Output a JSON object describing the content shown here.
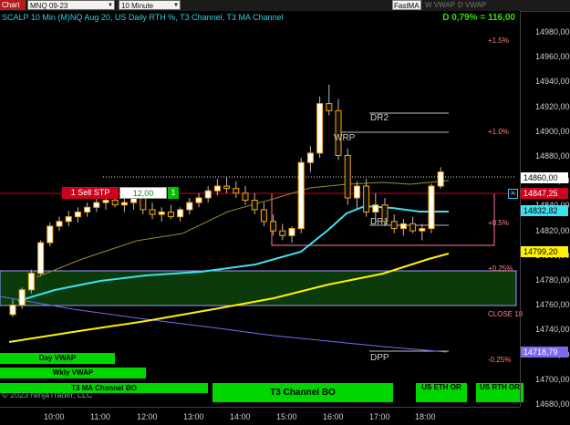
{
  "toolbar": {
    "chart_tab": "Chart",
    "instrument": "MNQ 09-23",
    "interval": "10 Minute",
    "fastma": "FastMA",
    "w_vwap": "W VWAP",
    "d_vwap": "D VWAP"
  },
  "chart_title": "SCALP 10 Min (M)NQ Aug 20, US Daily RTH %, T3 Channel, T3 MA Channel",
  "pnl": "D 0,79% = 116,00",
  "price_axis": [
    "14980,00",
    "14960,00",
    "14940,00",
    "14920,00",
    "14900,00",
    "14880,00",
    "14860,00",
    "14840,00",
    "14820,00",
    "14800,00",
    "14780,00",
    "14760,00",
    "14740,00",
    "14720,00",
    "14700,00",
    "14680,00"
  ],
  "price_flags": [
    {
      "label": "14860,00",
      "bg": "#ffffff",
      "fg": "#000000"
    },
    {
      "label": "14847,25",
      "bg": "#d0021b",
      "fg": "#ffffff"
    },
    {
      "label": "14832,82",
      "bg": "#3fe0f0",
      "fg": "#000000"
    },
    {
      "label": "14799,20",
      "bg": "#fff200",
      "fg": "#000000"
    },
    {
      "label": "14718,79",
      "bg": "#7a6bf0",
      "fg": "#ffffff"
    }
  ],
  "time_axis": [
    "10:00",
    "11:00",
    "12:00",
    "13:00",
    "14:00",
    "15:00",
    "16:00",
    "17:00",
    "18:00"
  ],
  "levels": {
    "pct_up_15": "+1.5%",
    "pct_up_10": "+1.0%",
    "pct_up_05": "+0.5%",
    "pct_up_025": "+0.25%",
    "close": "CLOSE 18",
    "pct_dn_025": "-0.25%",
    "dr2": "DR2",
    "wrp": "WRP",
    "dr1": "DR1",
    "dpp": "DPP"
  },
  "order": {
    "qty_label": "1 Sell STP",
    "price": "12,00",
    "cancel": "1"
  },
  "bars": {
    "day_vwap": "Day VWAP",
    "wkly_vwap": "Wkly VWAP",
    "t3_ma_channel_bo": "T3 MA Channel BO",
    "t3_channel_bo": "T3 Channel BO",
    "us_eth_or": "US ETH OR",
    "us_rth_or": "US RTH OR"
  },
  "copyright": "© 2023 NinjaTrader, LLC",
  "colors": {
    "cyan_ma": "#3fe0f0",
    "yellow_ma": "#fff200",
    "purple_vwap": "#7a6bf0",
    "order_line": "#d0021b",
    "channel_box": "#9a9aff",
    "box_fill": "#0b3a0b"
  },
  "chart_data": {
    "type": "candlestick",
    "y_axis_range": [
      14675,
      14990
    ],
    "candles": [
      {
        "t": "09:40",
        "o": 14737,
        "h": 14750,
        "l": 14735,
        "c": 14745
      },
      {
        "t": "09:50",
        "o": 14745,
        "h": 14760,
        "l": 14742,
        "c": 14758
      },
      {
        "t": "10:00",
        "o": 14758,
        "h": 14775,
        "l": 14755,
        "c": 14772
      },
      {
        "t": "10:10",
        "o": 14772,
        "h": 14800,
        "l": 14770,
        "c": 14798
      },
      {
        "t": "10:20",
        "o": 14798,
        "h": 14815,
        "l": 14795,
        "c": 14812
      },
      {
        "t": "10:30",
        "o": 14812,
        "h": 14820,
        "l": 14808,
        "c": 14816
      },
      {
        "t": "10:40",
        "o": 14816,
        "h": 14825,
        "l": 14812,
        "c": 14820
      },
      {
        "t": "10:50",
        "o": 14820,
        "h": 14828,
        "l": 14815,
        "c": 14824
      },
      {
        "t": "11:00",
        "o": 14824,
        "h": 14832,
        "l": 14820,
        "c": 14828
      },
      {
        "t": "11:10",
        "o": 14828,
        "h": 14836,
        "l": 14824,
        "c": 14832
      },
      {
        "t": "11:20",
        "o": 14832,
        "h": 14838,
        "l": 14826,
        "c": 14834
      },
      {
        "t": "11:30",
        "o": 14834,
        "h": 14840,
        "l": 14828,
        "c": 14830
      },
      {
        "t": "11:40",
        "o": 14830,
        "h": 14836,
        "l": 14824,
        "c": 14832
      },
      {
        "t": "11:50",
        "o": 14832,
        "h": 14840,
        "l": 14826,
        "c": 14836
      },
      {
        "t": "12:00",
        "o": 14836,
        "h": 14840,
        "l": 14822,
        "c": 14826
      },
      {
        "t": "12:10",
        "o": 14826,
        "h": 14832,
        "l": 14818,
        "c": 14822
      },
      {
        "t": "12:20",
        "o": 14822,
        "h": 14828,
        "l": 14816,
        "c": 14824
      },
      {
        "t": "12:30",
        "o": 14824,
        "h": 14830,
        "l": 14818,
        "c": 14820
      },
      {
        "t": "12:40",
        "o": 14820,
        "h": 14828,
        "l": 14816,
        "c": 14826
      },
      {
        "t": "12:50",
        "o": 14826,
        "h": 14836,
        "l": 14822,
        "c": 14832
      },
      {
        "t": "13:00",
        "o": 14832,
        "h": 14840,
        "l": 14828,
        "c": 14836
      },
      {
        "t": "13:10",
        "o": 14836,
        "h": 14846,
        "l": 14832,
        "c": 14842
      },
      {
        "t": "13:20",
        "o": 14842,
        "h": 14852,
        "l": 14838,
        "c": 14846
      },
      {
        "t": "13:30",
        "o": 14846,
        "h": 14854,
        "l": 14840,
        "c": 14844
      },
      {
        "t": "13:40",
        "o": 14844,
        "h": 14850,
        "l": 14836,
        "c": 14840
      },
      {
        "t": "13:50",
        "o": 14840,
        "h": 14846,
        "l": 14830,
        "c": 14834
      },
      {
        "t": "14:00",
        "o": 14834,
        "h": 14840,
        "l": 14822,
        "c": 14826
      },
      {
        "t": "14:10",
        "o": 14826,
        "h": 14832,
        "l": 14812,
        "c": 14816
      },
      {
        "t": "14:20",
        "o": 14816,
        "h": 14822,
        "l": 14804,
        "c": 14808
      },
      {
        "t": "14:30",
        "o": 14808,
        "h": 14814,
        "l": 14800,
        "c": 14804
      },
      {
        "t": "14:40",
        "o": 14804,
        "h": 14812,
        "l": 14798,
        "c": 14810
      },
      {
        "t": "14:50",
        "o": 14810,
        "h": 14870,
        "l": 14806,
        "c": 14866
      },
      {
        "t": "15:00",
        "o": 14866,
        "h": 14880,
        "l": 14858,
        "c": 14874
      },
      {
        "t": "15:10",
        "o": 14874,
        "h": 14922,
        "l": 14870,
        "c": 14916
      },
      {
        "t": "15:20",
        "o": 14916,
        "h": 14932,
        "l": 14906,
        "c": 14910
      },
      {
        "t": "15:30",
        "o": 14910,
        "h": 14920,
        "l": 14868,
        "c": 14872
      },
      {
        "t": "15:40",
        "o": 14872,
        "h": 14878,
        "l": 14830,
        "c": 14836
      },
      {
        "t": "15:50",
        "o": 14836,
        "h": 14850,
        "l": 14826,
        "c": 14846
      },
      {
        "t": "16:00",
        "o": 14846,
        "h": 14852,
        "l": 14820,
        "c": 14824
      },
      {
        "t": "16:10",
        "o": 14824,
        "h": 14840,
        "l": 14814,
        "c": 14830
      },
      {
        "t": "16:20",
        "o": 14830,
        "h": 14836,
        "l": 14812,
        "c": 14816
      },
      {
        "t": "16:30",
        "o": 14816,
        "h": 14822,
        "l": 14806,
        "c": 14810
      },
      {
        "t": "16:40",
        "o": 14810,
        "h": 14818,
        "l": 14804,
        "c": 14814
      },
      {
        "t": "16:50",
        "o": 14814,
        "h": 14820,
        "l": 14806,
        "c": 14808
      },
      {
        "t": "17:00",
        "o": 14808,
        "h": 14814,
        "l": 14800,
        "c": 14810
      },
      {
        "t": "17:10",
        "o": 14810,
        "h": 14848,
        "l": 14806,
        "c": 14846
      },
      {
        "t": "17:20",
        "o": 14846,
        "h": 14862,
        "l": 14844,
        "c": 14858
      }
    ],
    "lines": [
      {
        "name": "Day VWAP",
        "values": [
          14752,
          14770,
          14788,
          14798,
          14806,
          14812,
          14818,
          14822,
          14830,
          14832,
          14834,
          14836,
          14838,
          14836,
          14834,
          14833
        ]
      },
      {
        "name": "Wkly VWAP",
        "values": [
          14736,
          14740,
          14744,
          14748,
          14752,
          14756,
          14760,
          14764,
          14768,
          14772,
          14776,
          14780,
          14784,
          14790,
          14794,
          14799
        ]
      }
    ]
  }
}
